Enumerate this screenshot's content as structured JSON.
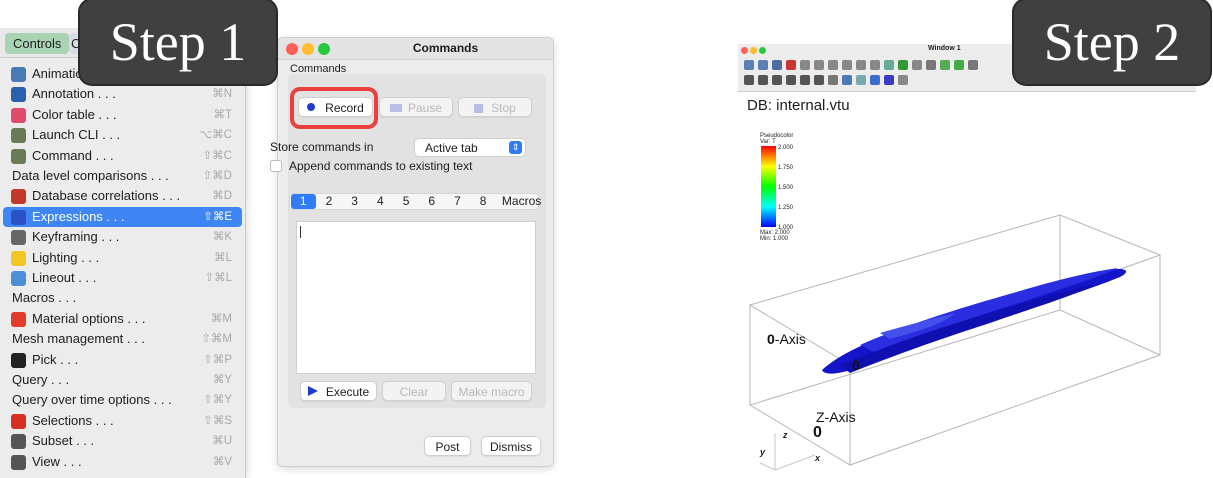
{
  "step_badges": {
    "step1": "Step 1",
    "step2": "Step 2"
  },
  "menubar": {
    "active": "Controls",
    "next_partial": "C"
  },
  "controls_menu": [
    {
      "label": "Animation . . .",
      "shortcut": "",
      "icon": "animation-icon",
      "color": "#4a7ab5"
    },
    {
      "label": "Annotation . . .",
      "shortcut": "⌘N",
      "icon": "annotation-icon",
      "color": "#2b5fb0"
    },
    {
      "label": "Color table . . .",
      "shortcut": "⌘T",
      "icon": "color-table-icon",
      "color": "#e04a6c"
    },
    {
      "label": "Launch CLI . . .",
      "shortcut": "⌥⌘C",
      "icon": "launch-cli-icon",
      "color": "#6a7a55"
    },
    {
      "label": "Command . . .",
      "shortcut": "⇧⌘C",
      "icon": "command-icon",
      "color": "#6a7a55"
    },
    {
      "label": "Data level comparisons . . .",
      "shortcut": "⇧⌘D",
      "icon": "",
      "color": ""
    },
    {
      "label": "Database correlations . . .",
      "shortcut": "⌘D",
      "icon": "database-correlations-icon",
      "color": "#c0392b"
    },
    {
      "label": "Expressions . . .",
      "shortcut": "⇧⌘E",
      "icon": "expressions-icon",
      "color": "#2a52c4",
      "selected": true
    },
    {
      "label": "Keyframing . . .",
      "shortcut": "⌘K",
      "icon": "keyframing-icon",
      "color": "#666666"
    },
    {
      "label": "Lighting . . .",
      "shortcut": "⌘L",
      "icon": "lighting-icon",
      "color": "#f3c623"
    },
    {
      "label": "Lineout . . .",
      "shortcut": "⇧⌘L",
      "icon": "lineout-icon",
      "color": "#4c8fd6"
    },
    {
      "label": "Macros . . .",
      "shortcut": "",
      "icon": "",
      "color": ""
    },
    {
      "label": "Material options . . .",
      "shortcut": "⌘M",
      "icon": "material-options-icon",
      "color": "#e23b2b"
    },
    {
      "label": "Mesh management . . .",
      "shortcut": "⇧⌘M",
      "icon": "",
      "color": ""
    },
    {
      "label": "Pick . . .",
      "shortcut": "⇧⌘P",
      "icon": "pick-icon",
      "color": "#222222"
    },
    {
      "label": "Query . . .",
      "shortcut": "⌘Y",
      "icon": "",
      "color": ""
    },
    {
      "label": "Query over time options . . .",
      "shortcut": "⇧⌘Y",
      "icon": "",
      "color": ""
    },
    {
      "label": "Selections . . .",
      "shortcut": "⇧⌘S",
      "icon": "selections-icon",
      "color": "#d62f24"
    },
    {
      "label": "Subset . . .",
      "shortcut": "⌘U",
      "icon": "subset-icon",
      "color": "#555555"
    },
    {
      "label": "View . . .",
      "shortcut": "⌘V",
      "icon": "view-icon",
      "color": "#555555"
    }
  ],
  "commands_window": {
    "title": "Commands",
    "group_title": "Commands",
    "record": "Record",
    "pause": "Pause",
    "stop": "Stop",
    "store_label": "Store commands in",
    "store_value": "Active tab",
    "append_label": "Append commands to existing text",
    "tabs": [
      "1",
      "2",
      "3",
      "4",
      "5",
      "6",
      "7",
      "8",
      "Macros"
    ],
    "execute": "Execute",
    "clear": "Clear",
    "make_macro": "Make macro",
    "post": "Post",
    "dismiss": "Dismiss"
  },
  "window1": {
    "title": "Window 1",
    "db_label": "DB: internal.vtu",
    "legend": {
      "title_line1": "Pseudocolor",
      "title_line2": "Var: T",
      "ticks": [
        "2.000",
        "1.750",
        "1.500",
        "1.250",
        "1.000"
      ],
      "max_line": "Max:  2.000",
      "min_line": "Min:  1.000"
    },
    "x_axis_label": "-Axis",
    "z_axis_label": "Z-Axis",
    "axis_zero_1": "0",
    "axis_zero_2": "0",
    "axis_zero_3": "0",
    "triad": {
      "z": "z",
      "y": "y",
      "x": "x"
    },
    "colors": {
      "surface": "#1414c8",
      "highlight": "#3a4ae0"
    }
  }
}
